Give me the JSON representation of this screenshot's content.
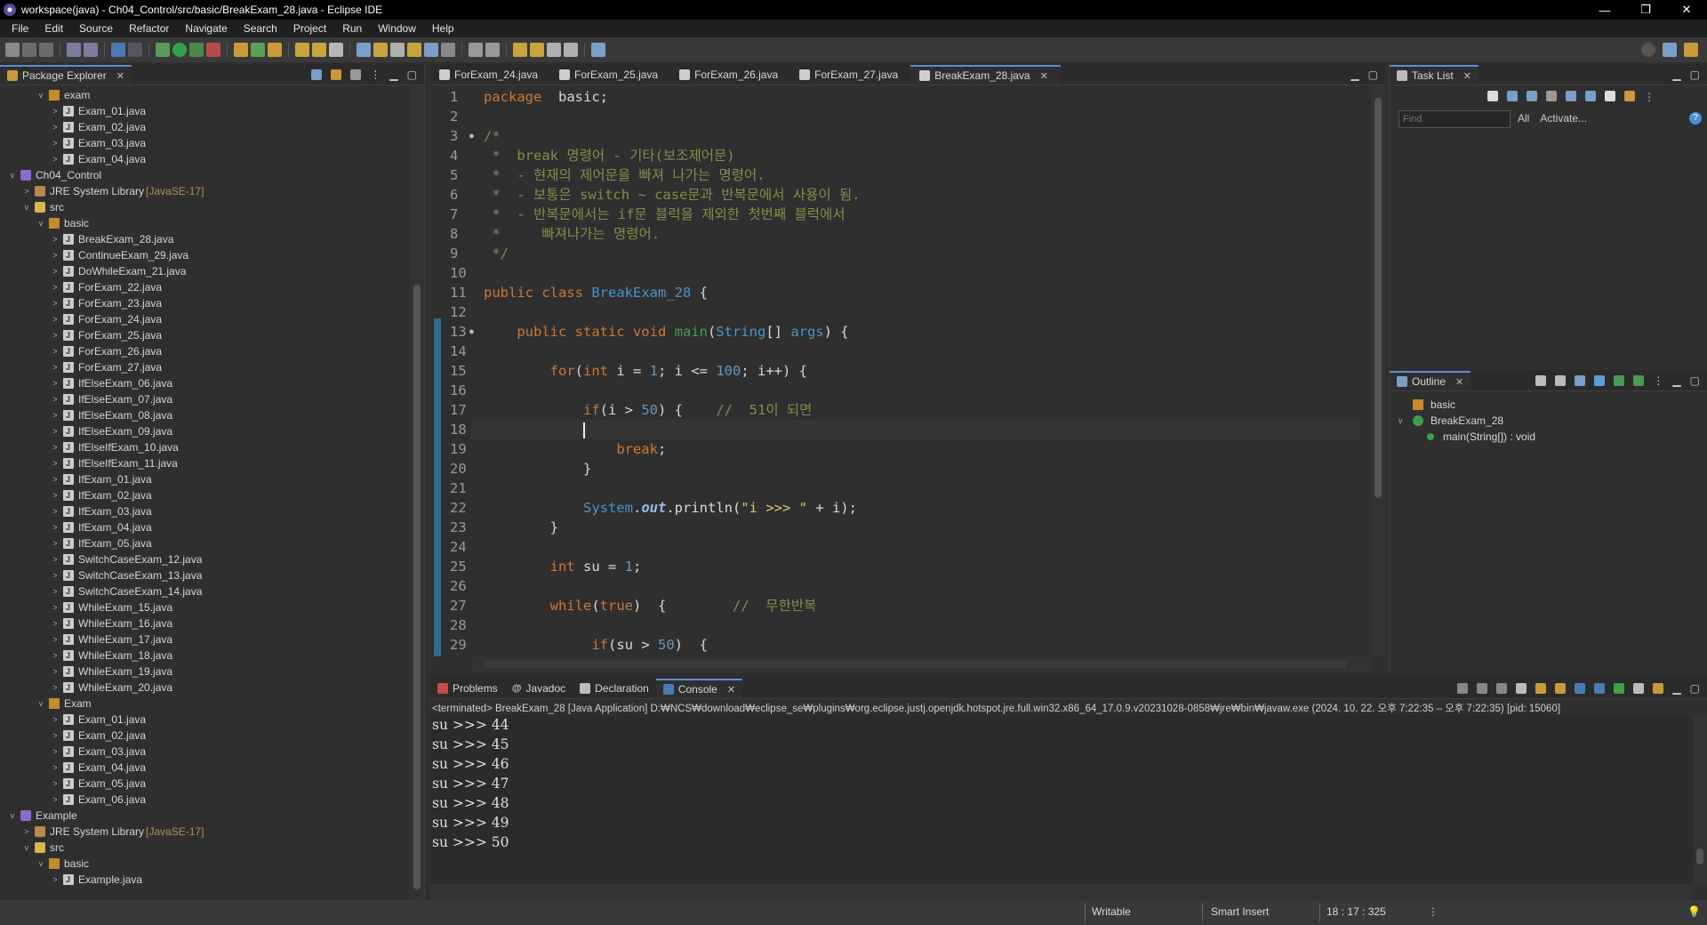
{
  "window": {
    "title": "workspace(java) - Ch04_Control/src/basic/BreakExam_28.java - Eclipse IDE",
    "controls": [
      "—",
      "❐",
      "✕"
    ]
  },
  "menu": [
    "File",
    "Edit",
    "Source",
    "Refactor",
    "Navigate",
    "Search",
    "Project",
    "Run",
    "Window",
    "Help"
  ],
  "package_explorer": {
    "tab_label": "Package Explorer",
    "tree": [
      {
        "depth": 2,
        "arrow": "v",
        "icon": "pkg",
        "label": "exam"
      },
      {
        "depth": 3,
        "arrow": ">",
        "icon": "file",
        "label": "Exam_01.java"
      },
      {
        "depth": 3,
        "arrow": ">",
        "icon": "file",
        "label": "Exam_02.java"
      },
      {
        "depth": 3,
        "arrow": ">",
        "icon": "file",
        "label": "Exam_03.java"
      },
      {
        "depth": 3,
        "arrow": ">",
        "icon": "file",
        "label": "Exam_04.java"
      },
      {
        "depth": 0,
        "arrow": "v",
        "icon": "project",
        "label": "Ch04_Control"
      },
      {
        "depth": 1,
        "arrow": ">",
        "icon": "lib",
        "label": "JRE System Library",
        "suffix": "[JavaSE-17]"
      },
      {
        "depth": 1,
        "arrow": "v",
        "icon": "folder",
        "label": "src"
      },
      {
        "depth": 2,
        "arrow": "v",
        "icon": "pkg",
        "label": "basic"
      },
      {
        "depth": 3,
        "arrow": ">",
        "icon": "file",
        "label": "BreakExam_28.java"
      },
      {
        "depth": 3,
        "arrow": ">",
        "icon": "file",
        "label": "ContinueExam_29.java"
      },
      {
        "depth": 3,
        "arrow": ">",
        "icon": "file",
        "label": "DoWhileExam_21.java"
      },
      {
        "depth": 3,
        "arrow": ">",
        "icon": "file",
        "label": "ForExam_22.java"
      },
      {
        "depth": 3,
        "arrow": ">",
        "icon": "file",
        "label": "ForExam_23.java"
      },
      {
        "depth": 3,
        "arrow": ">",
        "icon": "file",
        "label": "ForExam_24.java"
      },
      {
        "depth": 3,
        "arrow": ">",
        "icon": "file",
        "label": "ForExam_25.java"
      },
      {
        "depth": 3,
        "arrow": ">",
        "icon": "file",
        "label": "ForExam_26.java"
      },
      {
        "depth": 3,
        "arrow": ">",
        "icon": "file",
        "label": "ForExam_27.java"
      },
      {
        "depth": 3,
        "arrow": ">",
        "icon": "file",
        "label": "IfElseExam_06.java"
      },
      {
        "depth": 3,
        "arrow": ">",
        "icon": "file",
        "label": "IfElseExam_07.java"
      },
      {
        "depth": 3,
        "arrow": ">",
        "icon": "file",
        "label": "IfElseExam_08.java"
      },
      {
        "depth": 3,
        "arrow": ">",
        "icon": "file",
        "label": "IfElseExam_09.java"
      },
      {
        "depth": 3,
        "arrow": ">",
        "icon": "file",
        "label": "IfElseIfExam_10.java"
      },
      {
        "depth": 3,
        "arrow": ">",
        "icon": "file",
        "label": "IfElseIfExam_11.java"
      },
      {
        "depth": 3,
        "arrow": ">",
        "icon": "file",
        "label": "IfExam_01.java"
      },
      {
        "depth": 3,
        "arrow": ">",
        "icon": "file",
        "label": "IfExam_02.java"
      },
      {
        "depth": 3,
        "arrow": ">",
        "icon": "file",
        "label": "IfExam_03.java"
      },
      {
        "depth": 3,
        "arrow": ">",
        "icon": "file",
        "label": "IfExam_04.java"
      },
      {
        "depth": 3,
        "arrow": ">",
        "icon": "file",
        "label": "IfExam_05.java"
      },
      {
        "depth": 3,
        "arrow": ">",
        "icon": "file",
        "label": "SwitchCaseExam_12.java"
      },
      {
        "depth": 3,
        "arrow": ">",
        "icon": "file",
        "label": "SwitchCaseExam_13.java"
      },
      {
        "depth": 3,
        "arrow": ">",
        "icon": "file",
        "label": "SwitchCaseExam_14.java"
      },
      {
        "depth": 3,
        "arrow": ">",
        "icon": "file",
        "label": "WhileExam_15.java"
      },
      {
        "depth": 3,
        "arrow": ">",
        "icon": "file",
        "label": "WhileExam_16.java"
      },
      {
        "depth": 3,
        "arrow": ">",
        "icon": "file",
        "label": "WhileExam_17.java"
      },
      {
        "depth": 3,
        "arrow": ">",
        "icon": "file",
        "label": "WhileExam_18.java"
      },
      {
        "depth": 3,
        "arrow": ">",
        "icon": "file",
        "label": "WhileExam_19.java"
      },
      {
        "depth": 3,
        "arrow": ">",
        "icon": "file",
        "label": "WhileExam_20.java"
      },
      {
        "depth": 2,
        "arrow": "v",
        "icon": "pkg",
        "label": "Exam"
      },
      {
        "depth": 3,
        "arrow": ">",
        "icon": "file",
        "label": "Exam_01.java"
      },
      {
        "depth": 3,
        "arrow": ">",
        "icon": "file",
        "label": "Exam_02.java"
      },
      {
        "depth": 3,
        "arrow": ">",
        "icon": "file",
        "label": "Exam_03.java"
      },
      {
        "depth": 3,
        "arrow": ">",
        "icon": "file",
        "label": "Exam_04.java"
      },
      {
        "depth": 3,
        "arrow": ">",
        "icon": "file",
        "label": "Exam_05.java"
      },
      {
        "depth": 3,
        "arrow": ">",
        "icon": "file",
        "label": "Exam_06.java"
      },
      {
        "depth": 0,
        "arrow": "v",
        "icon": "project",
        "label": "Example"
      },
      {
        "depth": 1,
        "arrow": ">",
        "icon": "lib",
        "label": "JRE System Library",
        "suffix": "[JavaSE-17]"
      },
      {
        "depth": 1,
        "arrow": "v",
        "icon": "folder",
        "label": "src"
      },
      {
        "depth": 2,
        "arrow": "v",
        "icon": "pkg",
        "label": "basic"
      },
      {
        "depth": 3,
        "arrow": ">",
        "icon": "file",
        "label": "Example.java"
      }
    ]
  },
  "editor": {
    "tabs": [
      {
        "label": "ForExam_24.java",
        "active": false
      },
      {
        "label": "ForExam_25.java",
        "active": false
      },
      {
        "label": "ForExam_26.java",
        "active": false
      },
      {
        "label": "ForExam_27.java",
        "active": false
      },
      {
        "label": "BreakExam_28.java",
        "active": true
      }
    ],
    "current_line": 18,
    "lines": [
      {
        "n": "1",
        "segs": [
          [
            "kw",
            "package"
          ],
          [
            "",
            "  basic;"
          ]
        ]
      },
      {
        "n": "2",
        "segs": []
      },
      {
        "n": "3",
        "fold": true,
        "segs": [
          [
            "cmt",
            "/*"
          ]
        ]
      },
      {
        "n": "4",
        "segs": [
          [
            "cmt",
            " *  break 명령어 - 기타(보조제어문)"
          ]
        ]
      },
      {
        "n": "5",
        "segs": [
          [
            "cmt",
            " *  - 현재의 제어문을 빠져 나가는 명령어."
          ]
        ]
      },
      {
        "n": "6",
        "segs": [
          [
            "cmt",
            " *  - 보통은 switch ~ case문과 반복문에서 사용이 됨."
          ]
        ]
      },
      {
        "n": "7",
        "segs": [
          [
            "cmt",
            " *  - 반복문에서는 if문 블럭을 제외한 첫번째 블럭에서"
          ]
        ]
      },
      {
        "n": "8",
        "segs": [
          [
            "cmt",
            " *     빠져나가는 명령어."
          ]
        ]
      },
      {
        "n": "9",
        "segs": [
          [
            "cmt",
            " */"
          ]
        ]
      },
      {
        "n": "10",
        "segs": []
      },
      {
        "n": "11",
        "segs": [
          [
            "kw",
            "public class "
          ],
          [
            "typ",
            "BreakExam_28"
          ],
          [
            "",
            " {"
          ]
        ]
      },
      {
        "n": "12",
        "segs": []
      },
      {
        "n": "13",
        "fold": true,
        "segs": [
          [
            "",
            "    "
          ],
          [
            "kw",
            "public static void "
          ],
          [
            "fn",
            "main"
          ],
          [
            "",
            "("
          ],
          [
            "typ",
            "String"
          ],
          [
            "",
            "[] "
          ],
          [
            "typ",
            "args"
          ],
          [
            "",
            ") {"
          ]
        ]
      },
      {
        "n": "14",
        "segs": []
      },
      {
        "n": "15",
        "segs": [
          [
            "",
            "        "
          ],
          [
            "kw",
            "for"
          ],
          [
            "",
            "("
          ],
          [
            "kw",
            "int"
          ],
          [
            "",
            " i = "
          ],
          [
            "num",
            "1"
          ],
          [
            "",
            "; i <= "
          ],
          [
            "num",
            "100"
          ],
          [
            "",
            "; i++) {"
          ]
        ]
      },
      {
        "n": "16",
        "segs": []
      },
      {
        "n": "17",
        "segs": [
          [
            "",
            "            "
          ],
          [
            "kw",
            "if"
          ],
          [
            "",
            "(i > "
          ],
          [
            "num",
            "50"
          ],
          [
            "",
            ") {    "
          ],
          [
            "cmt",
            "//  51이 되면"
          ]
        ]
      },
      {
        "n": "18",
        "segs": [
          [
            "",
            "            "
          ]
        ],
        "cursor": true
      },
      {
        "n": "19",
        "segs": [
          [
            "",
            "                "
          ],
          [
            "bkw",
            "break"
          ],
          [
            "",
            ";"
          ]
        ]
      },
      {
        "n": "20",
        "segs": [
          [
            "",
            "            }"
          ]
        ]
      },
      {
        "n": "21",
        "segs": []
      },
      {
        "n": "22",
        "segs": [
          [
            "",
            "            "
          ],
          [
            "typ",
            "System"
          ],
          [
            "",
            "."
          ],
          [
            "fld",
            "out"
          ],
          [
            "",
            ".println("
          ],
          [
            "str",
            "\"i >>> \""
          ],
          [
            "",
            " + i);"
          ]
        ]
      },
      {
        "n": "23",
        "segs": [
          [
            "",
            "        }"
          ]
        ]
      },
      {
        "n": "24",
        "segs": []
      },
      {
        "n": "25",
        "segs": [
          [
            "",
            "        "
          ],
          [
            "kw",
            "int"
          ],
          [
            "",
            " su = "
          ],
          [
            "num",
            "1"
          ],
          [
            "",
            ";"
          ]
        ]
      },
      {
        "n": "26",
        "segs": []
      },
      {
        "n": "27",
        "segs": [
          [
            "",
            "        "
          ],
          [
            "kw",
            "while"
          ],
          [
            "",
            "("
          ],
          [
            "kw",
            "true"
          ],
          [
            "",
            ")  {        "
          ],
          [
            "cmt",
            "//  무한반복"
          ]
        ]
      },
      {
        "n": "28",
        "segs": []
      },
      {
        "n": "29",
        "segs": [
          [
            "",
            "             "
          ],
          [
            "kw",
            "if"
          ],
          [
            "",
            "(su > "
          ],
          [
            "num",
            "50"
          ],
          [
            "",
            ")  {"
          ]
        ]
      }
    ]
  },
  "task_list": {
    "tab_label": "Task List",
    "find_placeholder": "Find",
    "filter_all": "All",
    "filter_activate": "Activate..."
  },
  "outline": {
    "tab_label": "Outline",
    "items": [
      {
        "label": "basic",
        "icon": "pkg"
      },
      {
        "label": "BreakExam_28",
        "icon": "class"
      },
      {
        "label": "main(String[]) : void",
        "icon": "method"
      }
    ]
  },
  "console": {
    "tabs": [
      {
        "label": "Problems",
        "active": false
      },
      {
        "label": "Javadoc",
        "active": false
      },
      {
        "label": "Declaration",
        "active": false
      },
      {
        "label": "Console",
        "active": true
      }
    ],
    "header": "<terminated> BreakExam_28 [Java Application] D:₩NCS₩download₩eclipse_se₩plugins₩org.eclipse.justj.openjdk.hotspot.jre.full.win32.x86_64_17.0.9.v20231028-0858₩jre₩bin₩javaw.exe  (2024. 10. 22. 오후 7:22:35 – 오후 7:22:35) [pid: 15060]",
    "output": [
      "su >>> 44",
      "su >>> 45",
      "su >>> 46",
      "su >>> 47",
      "su >>> 48",
      "su >>> 49",
      "su >>> 50"
    ]
  },
  "status": {
    "writable": "Writable",
    "insert_mode": "Smart Insert",
    "position": "18 : 17 : 325"
  },
  "colors": {
    "keyword": "#cc7832",
    "comment": "#7f8f4a",
    "type": "#4a94c6",
    "accent_tab": "#5a8fd0"
  }
}
